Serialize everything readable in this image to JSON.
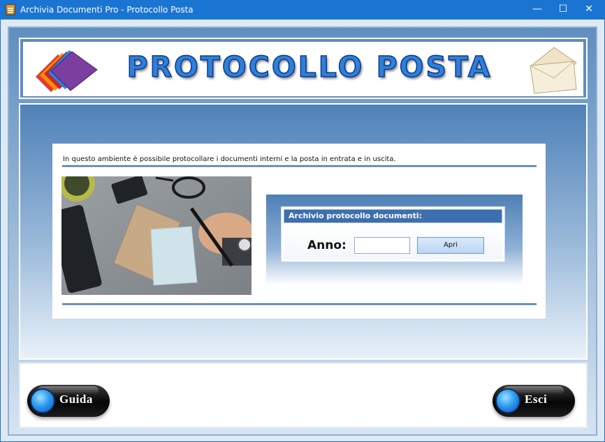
{
  "window": {
    "title": "Archivia Documenti Pro - Protocollo Posta",
    "minimize_glyph": "—",
    "maximize_glyph": "☐",
    "close_glyph": "✕"
  },
  "header": {
    "title": "PROTOCOLLO POSTA",
    "left_icon": "colored-papers-icon",
    "right_icon": "envelope-icon"
  },
  "main": {
    "intro_text": "In questo ambiente è possibile protocollare i documenti interni e la posta in entrata e in uscita.",
    "photo": "desk-photo-envelopes-phone-glasses-pen",
    "archive": {
      "header": "Archivio protocollo documenti:",
      "year_label": "Anno:",
      "year_value": "",
      "open_button": "Apri"
    }
  },
  "footer": {
    "help_button": "Guida",
    "exit_button": "Esci"
  },
  "colors": {
    "titlebar": "#1a75d2",
    "panel_gradient_top": "#4f81b8",
    "title_text": "#2e7fd8",
    "archive_header": "#3d6fb0"
  }
}
